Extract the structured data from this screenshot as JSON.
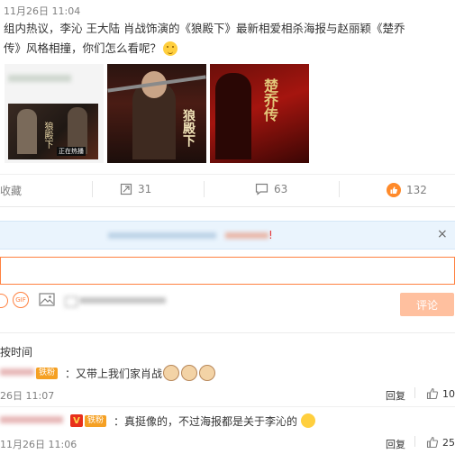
{
  "post": {
    "timestamp": "11月26日 11:04",
    "text_line1": "组内热议，李沁 王大陆 肖战饰演的《狼殿下》最新相爱相杀海报与赵丽颖《楚乔",
    "text_line2": "传》风格相撞，你们怎么看呢？",
    "thumb1_poster_title": "狼殿下",
    "thumb1_caption": "正在热播",
    "thumb3_title": "楚乔传"
  },
  "actions": {
    "favorite_label": "收藏",
    "repost_count": "31",
    "comment_count": "63",
    "like_count": "132"
  },
  "composer": {
    "submit_label": "评论"
  },
  "comments": {
    "sort_label": "按时间",
    "items": [
      {
        "badge": "铁粉",
        "text": "：又带上我们家肖战",
        "time": "26日 11:07",
        "reply": "回复",
        "likes": "10"
      },
      {
        "badge_level": "V",
        "badge": "铁粉",
        "text": "：真挺像的，不过海报都是关于李沁的",
        "time": "11月26日 11:06",
        "reply": "回复",
        "likes": "25"
      }
    ]
  },
  "colors": {
    "accent": "#ff8140",
    "submit_button": "#ffc09f",
    "muted": "#808080"
  }
}
